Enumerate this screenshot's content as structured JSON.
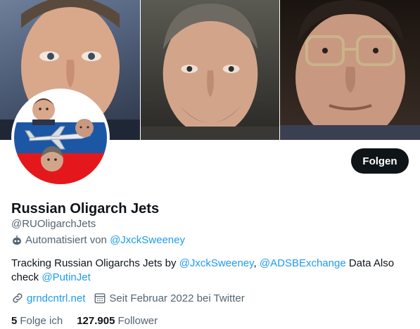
{
  "profile": {
    "display_name": "Russian Oligarch Jets",
    "handle": "@RUOligarchJets",
    "automated_prefix": "Automatisiert von",
    "automated_by": "@JxckSweeney",
    "bio_parts": {
      "p1": "Tracking Russian Oligarchs Jets by ",
      "m1": "@JxckSweeney",
      "p2": ", ",
      "m2": "@ADSBExchange",
      "p3": " Data Also check ",
      "m3": "@PutinJet"
    },
    "website": "grndcntrl.net",
    "joined": "Seit Februar 2022 bei Twitter",
    "following_count": "5",
    "following_label": "Folge ich",
    "followers_count": "127.905",
    "followers_label": "Follower"
  },
  "actions": {
    "follow_label": "Folgen"
  },
  "icons": {
    "automated": "robot-icon",
    "website": "link-icon",
    "joined": "calendar-icon"
  },
  "colors": {
    "text_primary": "#0f1419",
    "text_secondary": "#536471",
    "link": "#1d9bf0",
    "button_bg": "#0f1419",
    "flag_white": "#ffffff",
    "flag_blue": "#1c57a5",
    "flag_red": "#e4181c"
  }
}
